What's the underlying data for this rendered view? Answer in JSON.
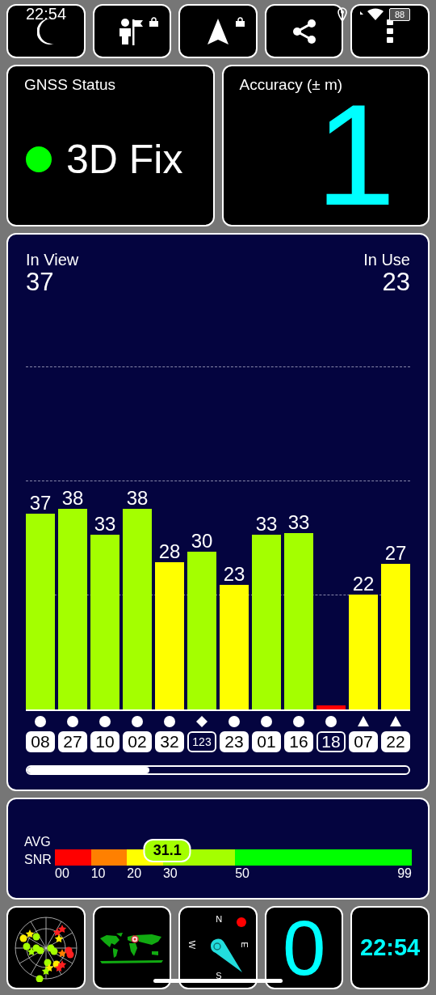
{
  "status_bar": {
    "time": "22:54",
    "battery": "88"
  },
  "toolbar": [
    {
      "kind": "night",
      "locked": false
    },
    {
      "kind": "flag",
      "locked": true
    },
    {
      "kind": "navigate",
      "locked": true
    },
    {
      "kind": "share",
      "locked": false
    },
    {
      "kind": "more",
      "locked": false
    }
  ],
  "gnss_status": {
    "title": "GNSS Status",
    "color": "#00ff00",
    "value": "3D Fix"
  },
  "accuracy": {
    "title": "Accuracy (± m)",
    "value": "1"
  },
  "satellites": {
    "in_view_label": "In View",
    "in_view": "37",
    "in_use_label": "In Use",
    "in_use": "23",
    "bars": [
      {
        "snr": "37",
        "color": "#a4ff00",
        "kind": "circle",
        "used": true,
        "number": "08"
      },
      {
        "snr": "38",
        "color": "#a4ff00",
        "kind": "circle",
        "used": true,
        "number": "27"
      },
      {
        "snr": "33",
        "color": "#a4ff00",
        "kind": "circle",
        "used": true,
        "number": "10"
      },
      {
        "snr": "38",
        "color": "#a4ff00",
        "kind": "circle",
        "used": true,
        "number": "02"
      },
      {
        "snr": "28",
        "color": "#ffff00",
        "kind": "circle",
        "used": true,
        "number": "32"
      },
      {
        "snr": "30",
        "color": "#a4ff00",
        "kind": "diamond",
        "used": false,
        "number": "123"
      },
      {
        "snr": "23",
        "color": "#ffff00",
        "kind": "circle",
        "used": true,
        "number": "23"
      },
      {
        "snr": "33",
        "color": "#a4ff00",
        "kind": "circle",
        "used": true,
        "number": "01"
      },
      {
        "snr": "33",
        "color": "#a4ff00",
        "kind": "circle",
        "used": true,
        "number": "16"
      },
      {
        "color": "#ff0000",
        "kind": "circle",
        "used": false,
        "number": "18"
      },
      {
        "snr": "22",
        "color": "#ffff00",
        "kind": "triangle",
        "used": true,
        "number": "07"
      },
      {
        "snr": "27",
        "color": "#ffff00",
        "kind": "triangle",
        "used": true,
        "number": "22"
      }
    ]
  },
  "snr": {
    "label_1": "AVG",
    "label_2": "SNR",
    "average": "31.1",
    "level": 0.315,
    "segments": [
      {
        "color": "#ff0000"
      },
      {
        "color": "#ff8000"
      },
      {
        "color": "#ffff00"
      },
      {
        "color": "#a4ff00"
      },
      {
        "color": "#00ff00"
      }
    ],
    "ticks": [
      "00",
      "10",
      "20",
      "30",
      "50",
      "99"
    ]
  },
  "bottom": {
    "compass": [
      "N",
      "E",
      "S",
      "W"
    ],
    "tile_4": "0",
    "clock": "22:54"
  }
}
